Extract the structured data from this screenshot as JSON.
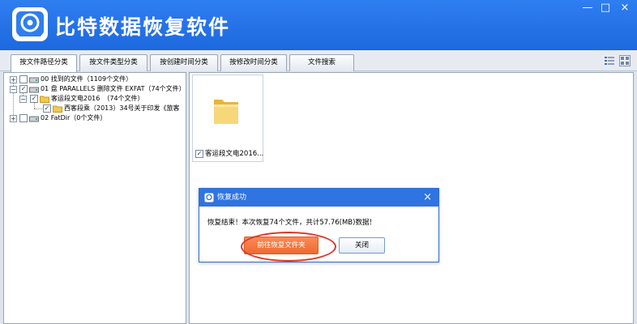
{
  "app": {
    "title": "比特数据恢复软件"
  },
  "window_controls": {
    "minimize": "—",
    "restore": "□",
    "close": "×"
  },
  "tabs": [
    {
      "label": "按文件路径分类",
      "active": true
    },
    {
      "label": "按文件类型分类",
      "active": false
    },
    {
      "label": "按创建时间分类",
      "active": false
    },
    {
      "label": "按修改时间分类",
      "active": false
    },
    {
      "label": "文件搜索",
      "active": false
    }
  ],
  "tree": [
    {
      "label": "00 找到的文件（1109个文件）",
      "expander": "+",
      "checked": false
    },
    {
      "label": "01 盘 PARALLELS 删除文件 EXFAT（74个文件）",
      "expander": "−",
      "checked": true
    },
    {
      "label": "客运段文电2016　（74个文件）",
      "expander": "−",
      "checked": true
    },
    {
      "label": "西客段乘（2013）34号关于印发《旅客",
      "expander": "",
      "checked": true
    },
    {
      "label": "02 FatDir（0个文件）",
      "expander": "+",
      "checked": false
    }
  ],
  "thumbnail": {
    "caption": "客运段文电2016...",
    "checked": true
  },
  "dialog": {
    "title": "恢复成功",
    "close": "×",
    "message": "恢复结束！本次恢复74个文件，共计57.76(MB)数据！",
    "primary_button": "前往恢复文件夹",
    "secondary_button": "关闭"
  },
  "colors": {
    "titlebar": "#2f7ef0",
    "accent_button": "#ee6a31",
    "highlight": "#d73a2c",
    "folder": "#f2c94c"
  }
}
